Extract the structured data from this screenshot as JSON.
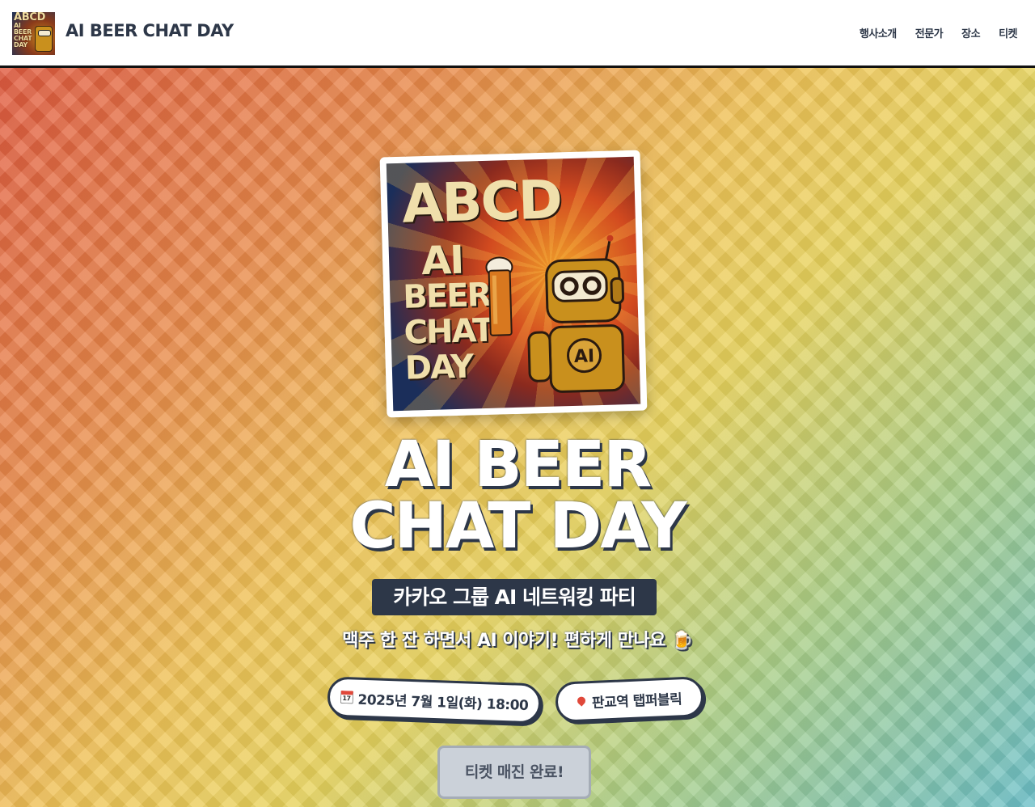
{
  "header": {
    "site_title": "AI BEER CHAT DAY",
    "logo": {
      "line1": "ABCD",
      "line2": "AI",
      "line3": "BEER",
      "line4": "CHAT",
      "line5": "DAY"
    },
    "nav": [
      {
        "label": "행사소개"
      },
      {
        "label": "전문가"
      },
      {
        "label": "장소"
      },
      {
        "label": "티켓"
      }
    ]
  },
  "hero": {
    "poster": {
      "title": "ABCD",
      "stack": [
        "AI",
        "BEER",
        "CHAT",
        "DAY"
      ],
      "robot_badge": "AI"
    },
    "title_line1": "AI BEER",
    "title_line2": "CHAT DAY",
    "badge": "카카오 그룹 AI 네트워킹 파티",
    "subline": "맥주 한 잔 하면서 AI 이야기! 편하게 만나요 🍺",
    "date_icon": "calendar-icon",
    "date_icon_day": "17",
    "date": "2025년 7월 1일(화) 18:00",
    "location_icon": "pin-icon",
    "location": "판교역 탭퍼블릭",
    "ticket_button": "티켓 매진 완료!"
  },
  "colors": {
    "dark": "#2d3748",
    "button_disabled": "#cbd1d9",
    "gradient": [
      "#e05a3f",
      "#f0c457",
      "#6cc0c9"
    ]
  }
}
